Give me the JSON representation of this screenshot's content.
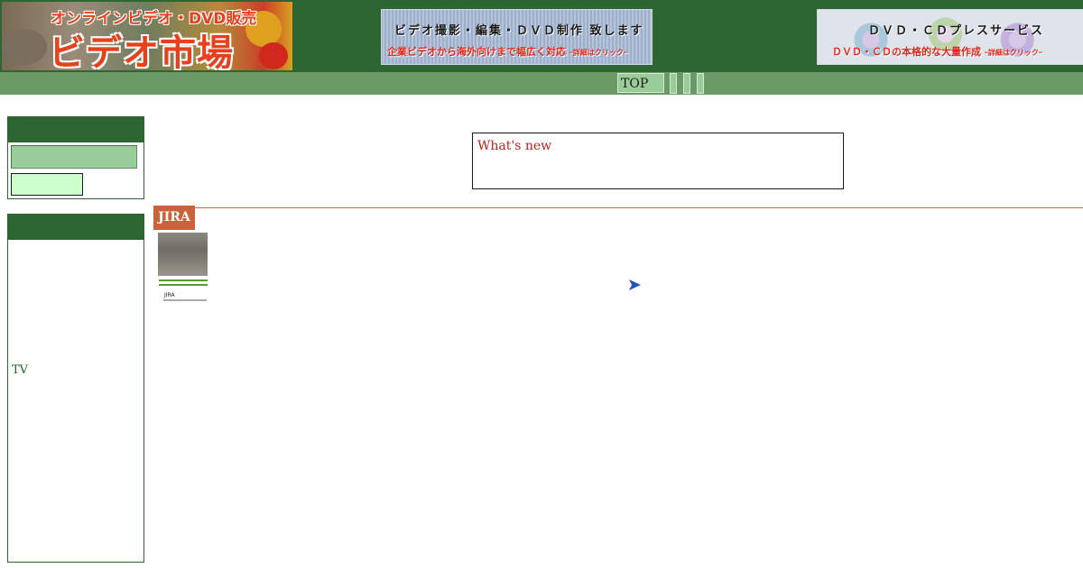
{
  "header": {
    "logo_top": "オンラインビデオ・DVD販売",
    "logo_main": "ビデオ市場",
    "banner_video": {
      "title": "ビデオ撮影・編集・ＤＶＤ制作 致します",
      "subtitle": "企業ビデオから海外向けまで幅広く対応",
      "link": "ｰ詳細はクリックｰ"
    },
    "banner_dvd": {
      "title": "ＤＶＤ・ＣＤプレスサービス",
      "subtitle": "ＤＶＤ・ＣＤの本格的な大量作成",
      "link": "ｰ詳細はクリックｰ"
    }
  },
  "nav": {
    "top_label": "TOP"
  },
  "sidebar": {
    "tv_label": "TV"
  },
  "main": {
    "whats_new_title": "What's new",
    "section_tag": "JIRA",
    "thumb_label": "JIRA"
  },
  "colors": {
    "header_green": "#2e6632",
    "nav_green": "#6a9a66",
    "tab_green": "#99cc99",
    "accent_orange": "#c8643c",
    "news_red": "#c0201c"
  }
}
